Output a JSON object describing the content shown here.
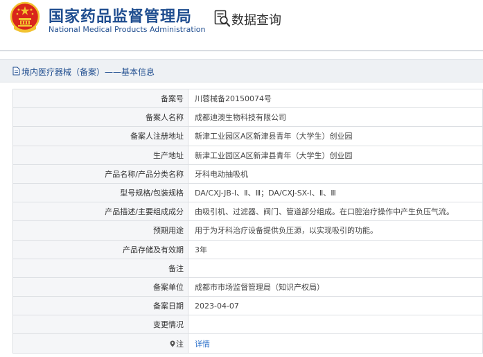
{
  "header": {
    "title": "国家药品监督管理局",
    "subtitle": "National Medical Products Administration",
    "query_title": "数据查询"
  },
  "section": {
    "title": "境内医疗器械（备案）——基本信息"
  },
  "rows": [
    {
      "label": "备案号",
      "value": "川蓉械备20150074号"
    },
    {
      "label": "备案人名称",
      "value": "成都迪澳生物科技有限公司"
    },
    {
      "label": "备案人注册地址",
      "value": "新津工业园区A区新津县青年（大学生）创业园"
    },
    {
      "label": "生产地址",
      "value": "新津工业园区A区新津县青年（大学生）创业园"
    },
    {
      "label": "产品名称/产品分类名称",
      "value": "牙科电动抽吸机"
    },
    {
      "label": "型号规格/包装规格",
      "value": "DA/CXJ-JB-Ⅰ、Ⅱ、Ⅲ；DA/CXJ-SX-Ⅰ、Ⅱ、Ⅲ"
    },
    {
      "label": "产品描述/主要组成成分",
      "value": "由吸引机、过滤器、阀门、管道部分组成。在口腔治疗操作中产生负压气流。"
    },
    {
      "label": "预期用途",
      "value": "用于为牙科治疗设备提供负压源，以实现吸引的功能。"
    },
    {
      "label": "产品存储及有效期",
      "value": "3年"
    },
    {
      "label": "备注",
      "value": ""
    },
    {
      "label": "备案单位",
      "value": "成都市市场监督管理局（知识产权局）"
    },
    {
      "label": "备案日期",
      "value": "2023-04-07"
    },
    {
      "label": "变更情况",
      "value": ""
    }
  ],
  "note_row": {
    "label": "注",
    "link": "详情"
  },
  "colors": {
    "brand_blue": "#1f4d8f",
    "emblem_red": "#d9261c",
    "emblem_gold": "#f2c230",
    "link_blue": "#2a6fc9"
  }
}
